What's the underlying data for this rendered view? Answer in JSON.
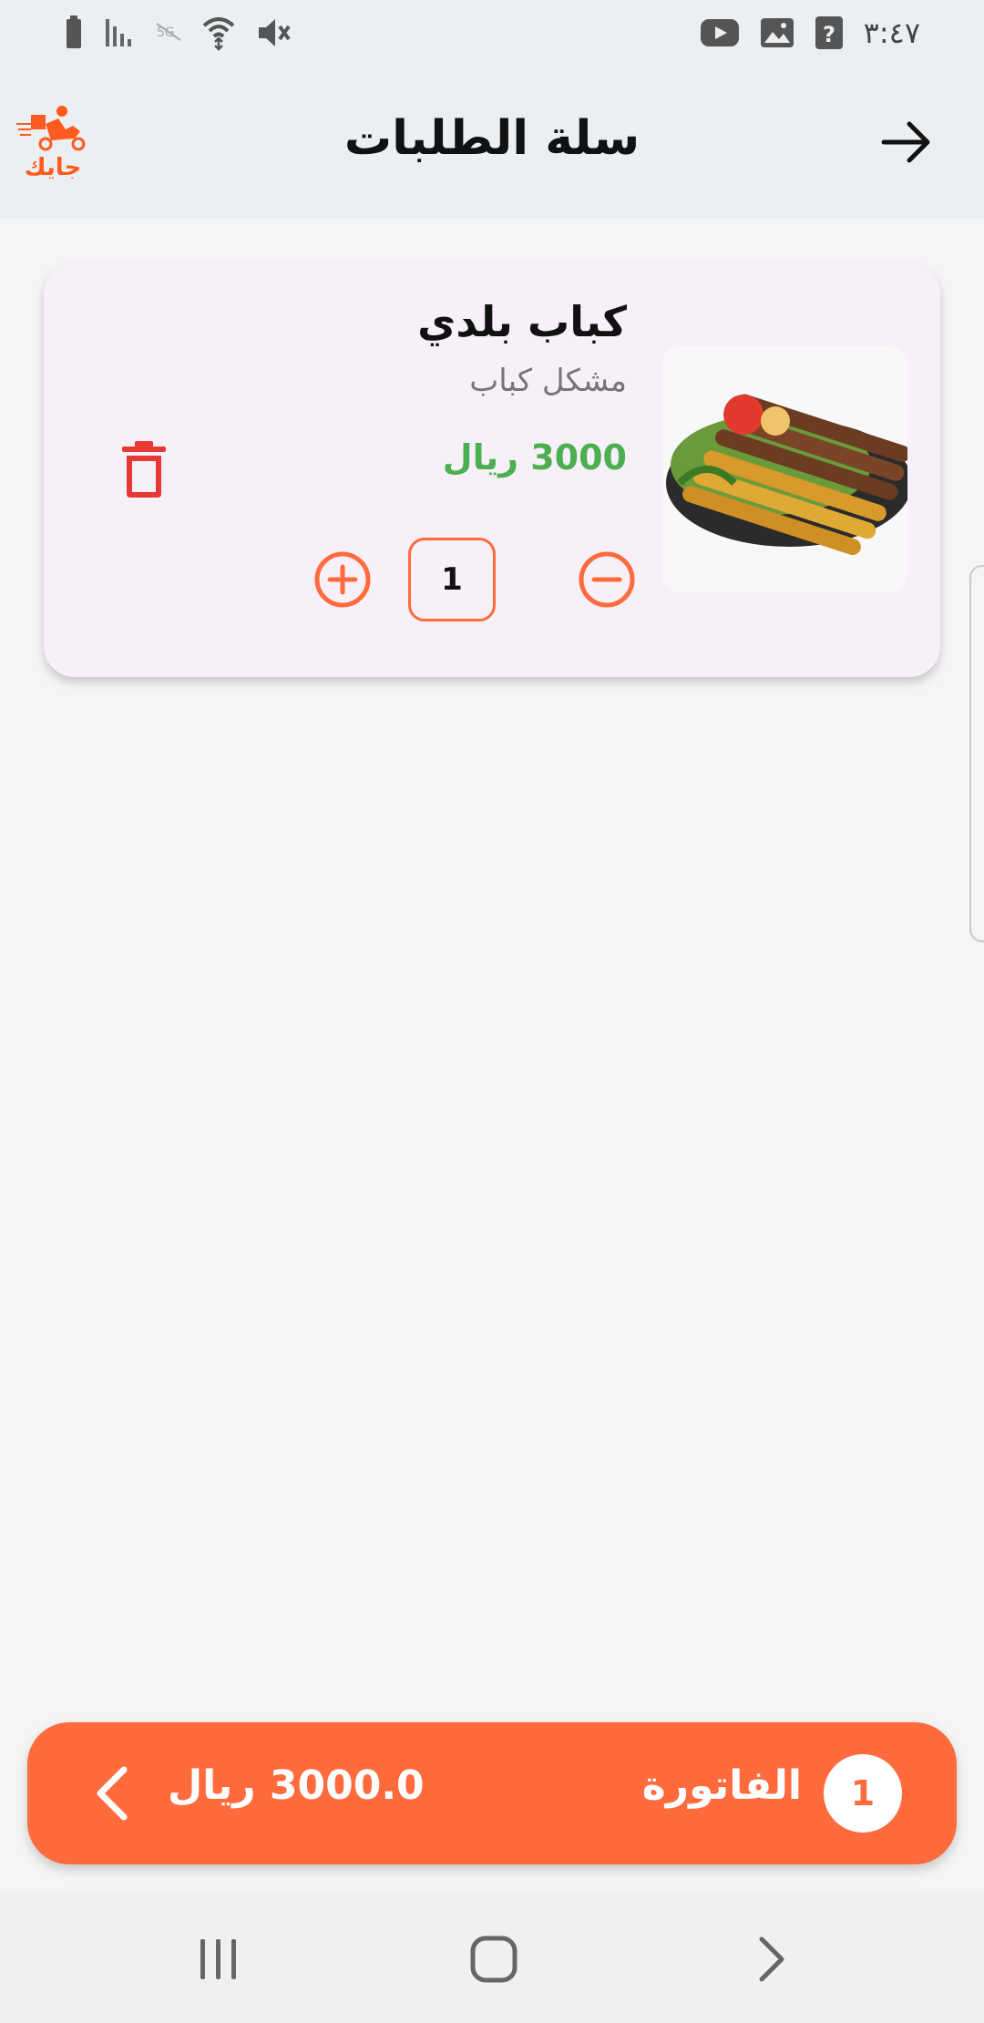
{
  "status_bar": {
    "time": "٣:٤٧",
    "icons": [
      "battery-icon",
      "signal-icon",
      "data-off-icon",
      "wifi-icon",
      "mute-icon",
      "youtube-icon",
      "gallery-icon",
      "help-icon"
    ]
  },
  "header": {
    "title": "سلة الطلبات",
    "logo_text": "جايك",
    "back_icon": "arrow-right-icon"
  },
  "cart": {
    "items": [
      {
        "name": "كباب بلدي",
        "description": "مشكل كباب",
        "price": "3000 ريال",
        "quantity": "1"
      }
    ]
  },
  "invoice": {
    "count": "1",
    "label": "الفاتورة",
    "total": "3000.0 ريال"
  },
  "colors": {
    "accent": "#ff6b3d",
    "price_green": "#4caf50",
    "delete_red": "#e53935",
    "card_bg": "#f7f0f8",
    "appbar_bg": "#eceff1"
  },
  "nav_bar": {
    "icons": [
      "recent-apps-icon",
      "home-icon",
      "back-icon"
    ]
  }
}
